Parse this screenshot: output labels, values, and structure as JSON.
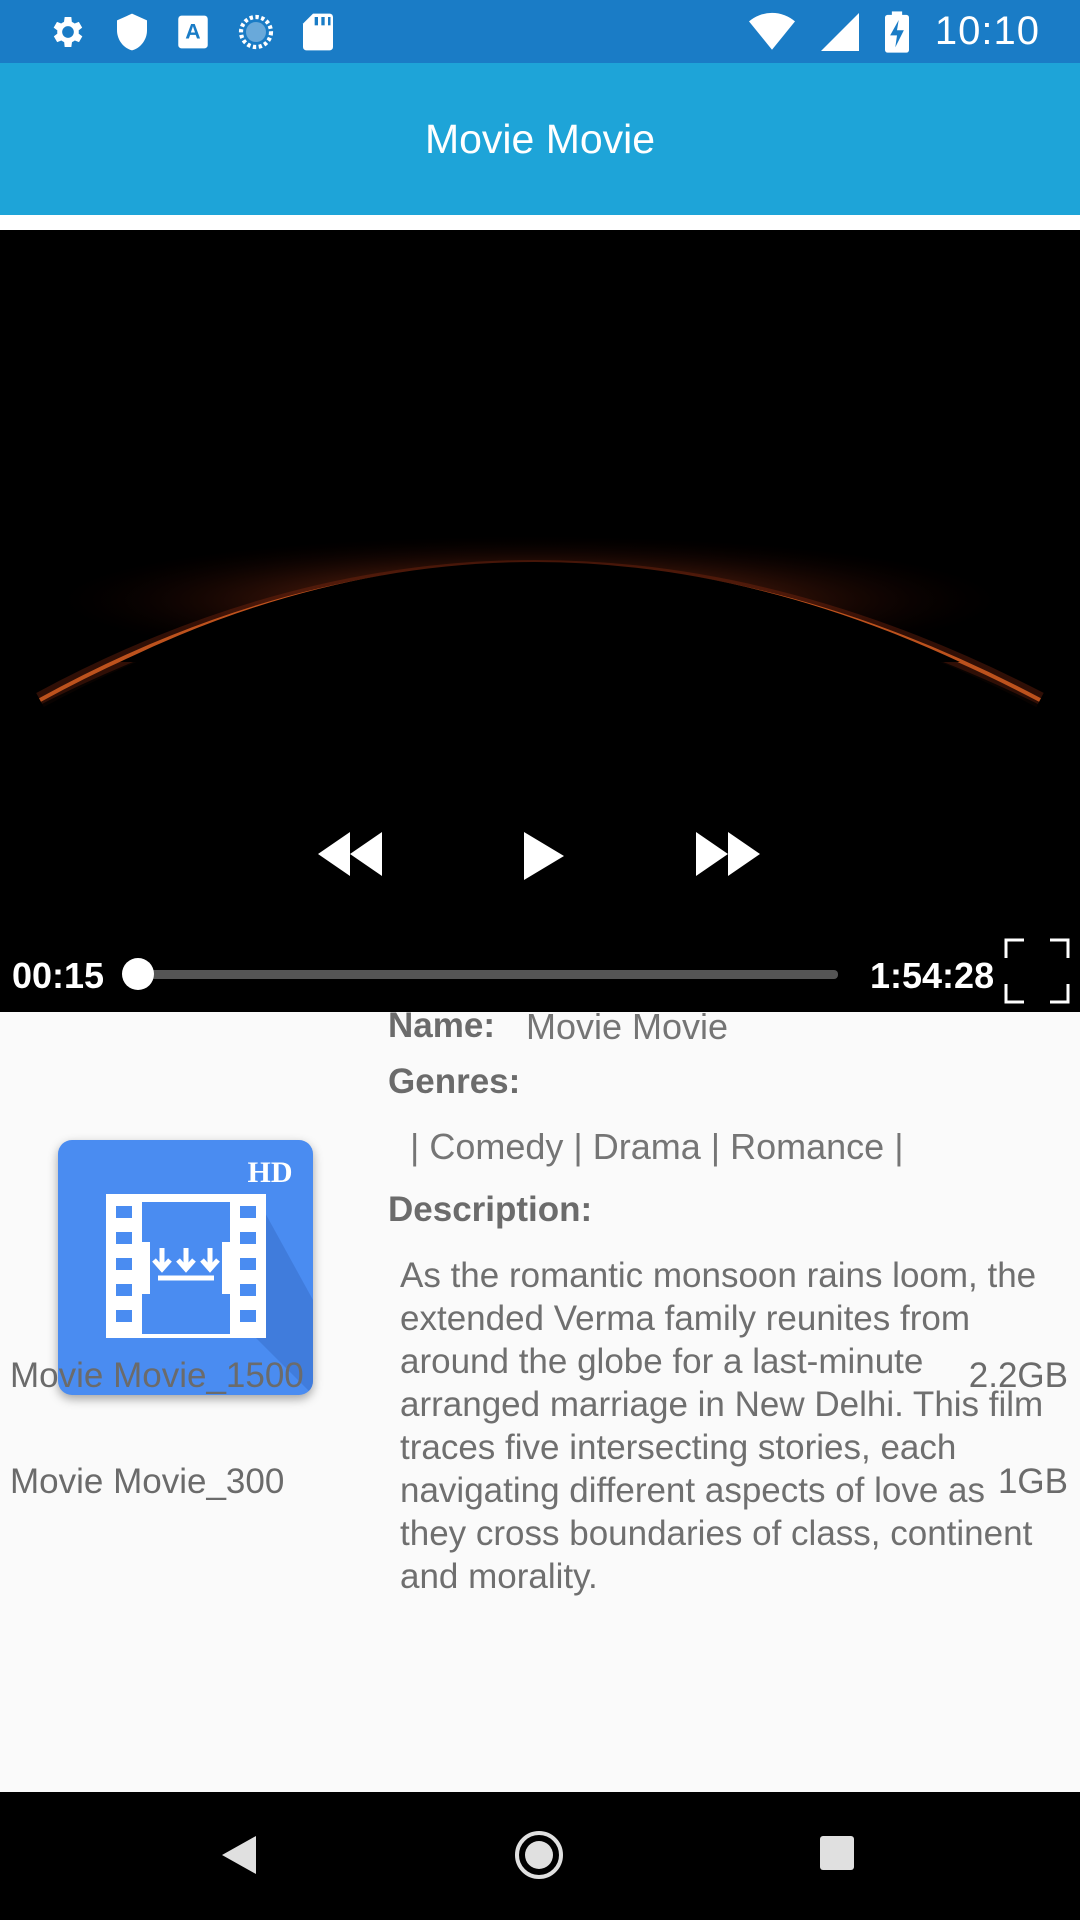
{
  "status_bar": {
    "time": "10:10",
    "left_icons": [
      "gear-icon",
      "shield-icon",
      "a-text-icon",
      "sync-circle-icon",
      "sd-card-icon"
    ],
    "right_icons": [
      "wifi-icon",
      "cellular-signal-icon",
      "battery-charging-icon"
    ]
  },
  "app_bar": {
    "title": "Movie Movie"
  },
  "player": {
    "current_time": "00:15",
    "total_time": "1:54:28",
    "progress": 0.002,
    "controls": [
      "rewind-icon",
      "play-icon",
      "fast-forward-icon",
      "fullscreen-icon"
    ]
  },
  "movie": {
    "name_label": "Name:",
    "name_value": "Movie Movie",
    "genres_label": "Genres:",
    "genres_value": " | Comedy | Drama | Romance |",
    "description_label": "Description:",
    "description_value": "As the romantic monsoon rains loom, the extended Verma family reunites from around the globe for a last-minute arranged marriage in New Delhi. This film traces five intersecting stories, each navigating different aspects of love as they cross boundaries of class, continent and morality.",
    "poster_badge": "HD"
  },
  "files": [
    {
      "name": "Movie Movie_1500",
      "size": "2.2GB"
    },
    {
      "name": "Movie Movie_300",
      "size": "1GB"
    }
  ],
  "nav_bar": {
    "buttons": [
      "back-icon",
      "home-icon",
      "recents-icon"
    ]
  }
}
